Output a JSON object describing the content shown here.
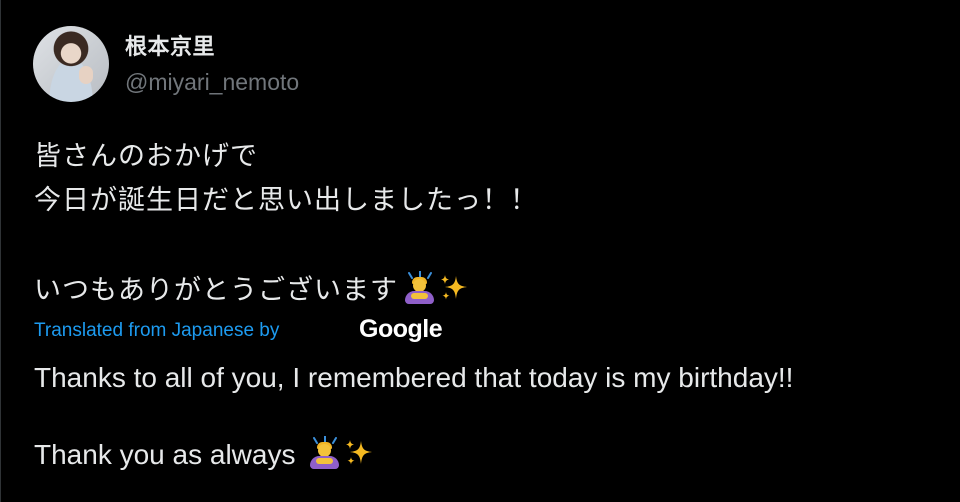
{
  "author": {
    "display_name": "根本京里",
    "handle": "@miyari_nemoto"
  },
  "tweet": {
    "line1": "皆さんのおかげで",
    "line2": "今日が誕生日だと思い出しましたっ！！",
    "line3": "いつもありがとうございます"
  },
  "translation": {
    "label": "Translated from Japanese by",
    "provider": "Google",
    "line1": "Thanks to all of you, I remembered that today is my birthday!!",
    "line2": "Thank you as always "
  },
  "emojis": [
    "person-bowing-icon",
    "sparkles-icon"
  ],
  "colors": {
    "background": "#000000",
    "text": "#e7e9ea",
    "muted": "#71767b",
    "link": "#1d9bf0"
  }
}
